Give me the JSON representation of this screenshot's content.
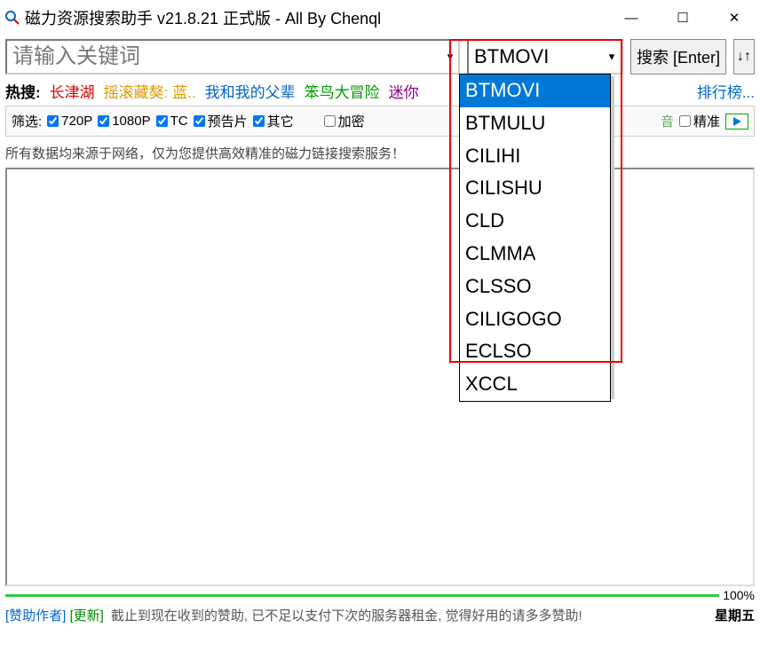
{
  "title": "磁力资源搜索助手 v21.8.21 正式版 - All By Chenql",
  "search": {
    "placeholder": "请输入关键词"
  },
  "source": {
    "selected": "BTMOVI",
    "options": [
      "BTMOVI",
      "BTMULU",
      "CILIHI",
      "CILISHU",
      "CLD",
      "CLMMA",
      "CLSSO",
      "CILIGOGO",
      "ECLSO",
      "XCCL"
    ]
  },
  "searchBtn": "搜索 [Enter]",
  "hot": {
    "label": "热搜:",
    "items": [
      {
        "text": "长津湖",
        "color": "#d00"
      },
      {
        "text": "摇滚藏獒: 蓝..",
        "color": "#d90"
      },
      {
        "text": "我和我的父辈",
        "color": "#06c"
      },
      {
        "text": "笨鸟大冒险",
        "color": "#090"
      },
      {
        "text": "迷你",
        "color": "#808"
      }
    ],
    "rank": "排行榜..."
  },
  "filter": {
    "label": "筛选:",
    "f720": "720P",
    "f1080": "1080P",
    "ftc": "TC",
    "ftrl": "预告片",
    "foth": "其它",
    "fenc": "加密",
    "fexa": "精准"
  },
  "info": "所有数据均来源于网络，仅为您提供高效精准的磁力链接搜索服务！",
  "progress": "100%",
  "footer": {
    "sponsor_a": "[赞助作者]",
    "sponsor_b": "[更新]",
    "msg": "截止到现在收到的赞助, 已不足以支付下次的服务器租金, 觉得好用的请多多赞助!",
    "day": "星期五"
  }
}
